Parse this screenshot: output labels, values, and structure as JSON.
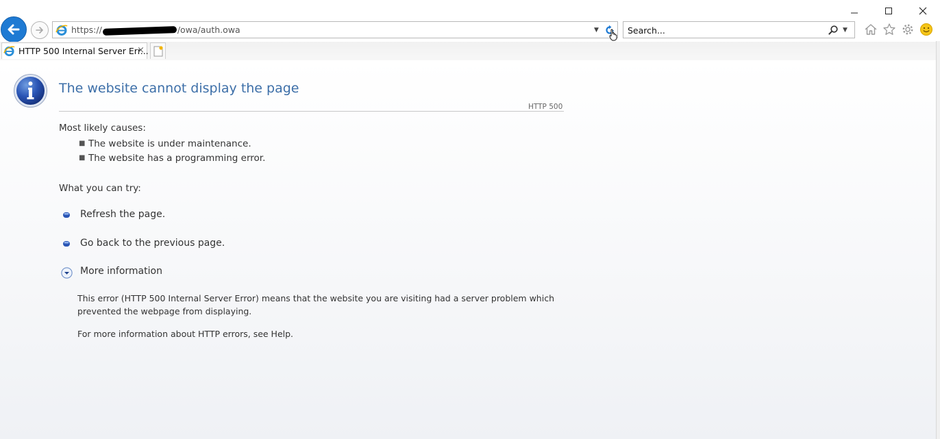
{
  "browser": {
    "address": {
      "url_prefix": "https://",
      "url_suffix": "/owa/auth.owa"
    },
    "search": {
      "placeholder": "Search..."
    },
    "tab": {
      "title": "HTTP 500 Internal Server Err...",
      "close_glyph": "×"
    },
    "window_controls": {
      "minimize": "—",
      "close": "✕"
    }
  },
  "page": {
    "heading": "The website cannot display the page",
    "code": "HTTP 500",
    "causes_label": "Most likely causes:",
    "causes": [
      "The website is under maintenance.",
      "The website has a programming error."
    ],
    "try_label": "What you can try:",
    "actions": [
      "Refresh the page.",
      "Go back to the previous page."
    ],
    "more_info": "More information",
    "details": {
      "line1": "This error (HTTP 500 Internal Server Error) means that the website you are visiting had a server problem which",
      "line2": "prevented the webpage from displaying.",
      "help": "For more information about HTTP errors, see Help."
    }
  },
  "colors": {
    "heading": "#3d6fa8",
    "accent": "#1e7ad3",
    "text": "#333333"
  }
}
